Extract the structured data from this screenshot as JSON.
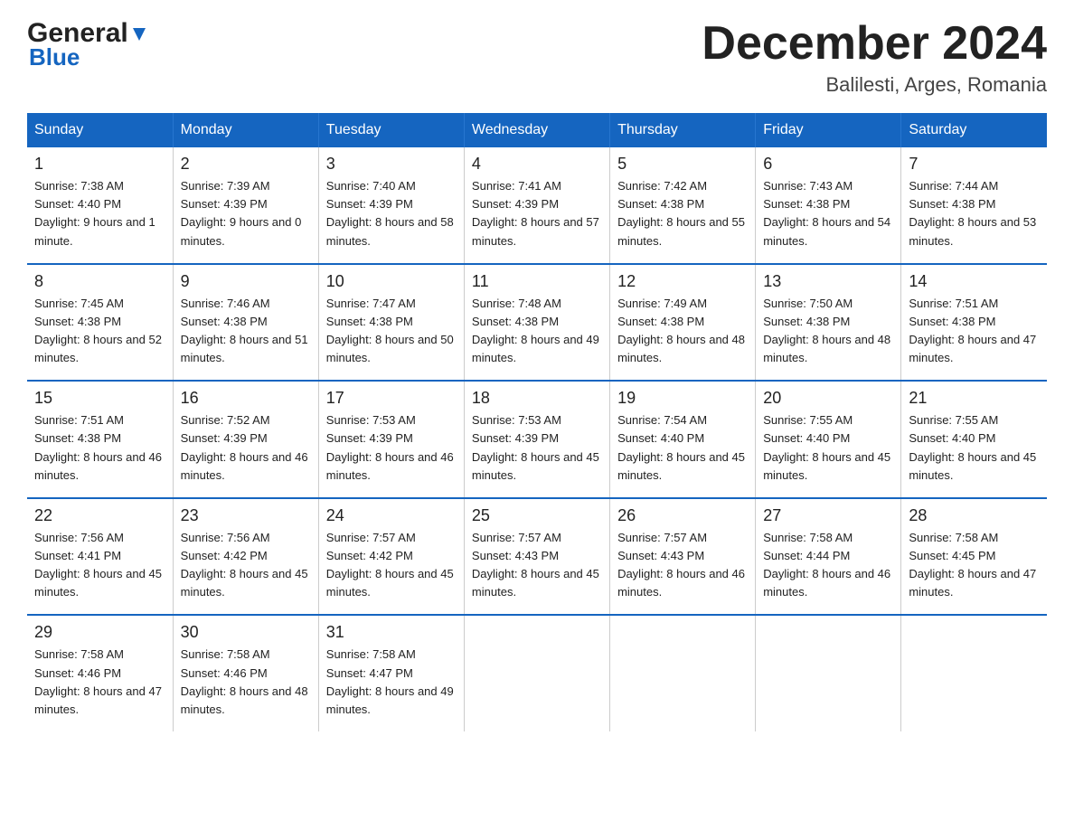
{
  "header": {
    "logo_general": "General",
    "logo_blue": "Blue",
    "title": "December 2024",
    "subtitle": "Balilesti, Arges, Romania"
  },
  "days_of_week": [
    "Sunday",
    "Monday",
    "Tuesday",
    "Wednesday",
    "Thursday",
    "Friday",
    "Saturday"
  ],
  "weeks": [
    [
      {
        "day": "1",
        "sunrise": "7:38 AM",
        "sunset": "4:40 PM",
        "daylight": "9 hours and 1 minute."
      },
      {
        "day": "2",
        "sunrise": "7:39 AM",
        "sunset": "4:39 PM",
        "daylight": "9 hours and 0 minutes."
      },
      {
        "day": "3",
        "sunrise": "7:40 AM",
        "sunset": "4:39 PM",
        "daylight": "8 hours and 58 minutes."
      },
      {
        "day": "4",
        "sunrise": "7:41 AM",
        "sunset": "4:39 PM",
        "daylight": "8 hours and 57 minutes."
      },
      {
        "day": "5",
        "sunrise": "7:42 AM",
        "sunset": "4:38 PM",
        "daylight": "8 hours and 55 minutes."
      },
      {
        "day": "6",
        "sunrise": "7:43 AM",
        "sunset": "4:38 PM",
        "daylight": "8 hours and 54 minutes."
      },
      {
        "day": "7",
        "sunrise": "7:44 AM",
        "sunset": "4:38 PM",
        "daylight": "8 hours and 53 minutes."
      }
    ],
    [
      {
        "day": "8",
        "sunrise": "7:45 AM",
        "sunset": "4:38 PM",
        "daylight": "8 hours and 52 minutes."
      },
      {
        "day": "9",
        "sunrise": "7:46 AM",
        "sunset": "4:38 PM",
        "daylight": "8 hours and 51 minutes."
      },
      {
        "day": "10",
        "sunrise": "7:47 AM",
        "sunset": "4:38 PM",
        "daylight": "8 hours and 50 minutes."
      },
      {
        "day": "11",
        "sunrise": "7:48 AM",
        "sunset": "4:38 PM",
        "daylight": "8 hours and 49 minutes."
      },
      {
        "day": "12",
        "sunrise": "7:49 AM",
        "sunset": "4:38 PM",
        "daylight": "8 hours and 48 minutes."
      },
      {
        "day": "13",
        "sunrise": "7:50 AM",
        "sunset": "4:38 PM",
        "daylight": "8 hours and 48 minutes."
      },
      {
        "day": "14",
        "sunrise": "7:51 AM",
        "sunset": "4:38 PM",
        "daylight": "8 hours and 47 minutes."
      }
    ],
    [
      {
        "day": "15",
        "sunrise": "7:51 AM",
        "sunset": "4:38 PM",
        "daylight": "8 hours and 46 minutes."
      },
      {
        "day": "16",
        "sunrise": "7:52 AM",
        "sunset": "4:39 PM",
        "daylight": "8 hours and 46 minutes."
      },
      {
        "day": "17",
        "sunrise": "7:53 AM",
        "sunset": "4:39 PM",
        "daylight": "8 hours and 46 minutes."
      },
      {
        "day": "18",
        "sunrise": "7:53 AM",
        "sunset": "4:39 PM",
        "daylight": "8 hours and 45 minutes."
      },
      {
        "day": "19",
        "sunrise": "7:54 AM",
        "sunset": "4:40 PM",
        "daylight": "8 hours and 45 minutes."
      },
      {
        "day": "20",
        "sunrise": "7:55 AM",
        "sunset": "4:40 PM",
        "daylight": "8 hours and 45 minutes."
      },
      {
        "day": "21",
        "sunrise": "7:55 AM",
        "sunset": "4:40 PM",
        "daylight": "8 hours and 45 minutes."
      }
    ],
    [
      {
        "day": "22",
        "sunrise": "7:56 AM",
        "sunset": "4:41 PM",
        "daylight": "8 hours and 45 minutes."
      },
      {
        "day": "23",
        "sunrise": "7:56 AM",
        "sunset": "4:42 PM",
        "daylight": "8 hours and 45 minutes."
      },
      {
        "day": "24",
        "sunrise": "7:57 AM",
        "sunset": "4:42 PM",
        "daylight": "8 hours and 45 minutes."
      },
      {
        "day": "25",
        "sunrise": "7:57 AM",
        "sunset": "4:43 PM",
        "daylight": "8 hours and 45 minutes."
      },
      {
        "day": "26",
        "sunrise": "7:57 AM",
        "sunset": "4:43 PM",
        "daylight": "8 hours and 46 minutes."
      },
      {
        "day": "27",
        "sunrise": "7:58 AM",
        "sunset": "4:44 PM",
        "daylight": "8 hours and 46 minutes."
      },
      {
        "day": "28",
        "sunrise": "7:58 AM",
        "sunset": "4:45 PM",
        "daylight": "8 hours and 47 minutes."
      }
    ],
    [
      {
        "day": "29",
        "sunrise": "7:58 AM",
        "sunset": "4:46 PM",
        "daylight": "8 hours and 47 minutes."
      },
      {
        "day": "30",
        "sunrise": "7:58 AM",
        "sunset": "4:46 PM",
        "daylight": "8 hours and 48 minutes."
      },
      {
        "day": "31",
        "sunrise": "7:58 AM",
        "sunset": "4:47 PM",
        "daylight": "8 hours and 49 minutes."
      },
      null,
      null,
      null,
      null
    ]
  ],
  "labels": {
    "sunrise_prefix": "Sunrise: ",
    "sunset_prefix": "Sunset: ",
    "daylight_prefix": "Daylight: "
  }
}
